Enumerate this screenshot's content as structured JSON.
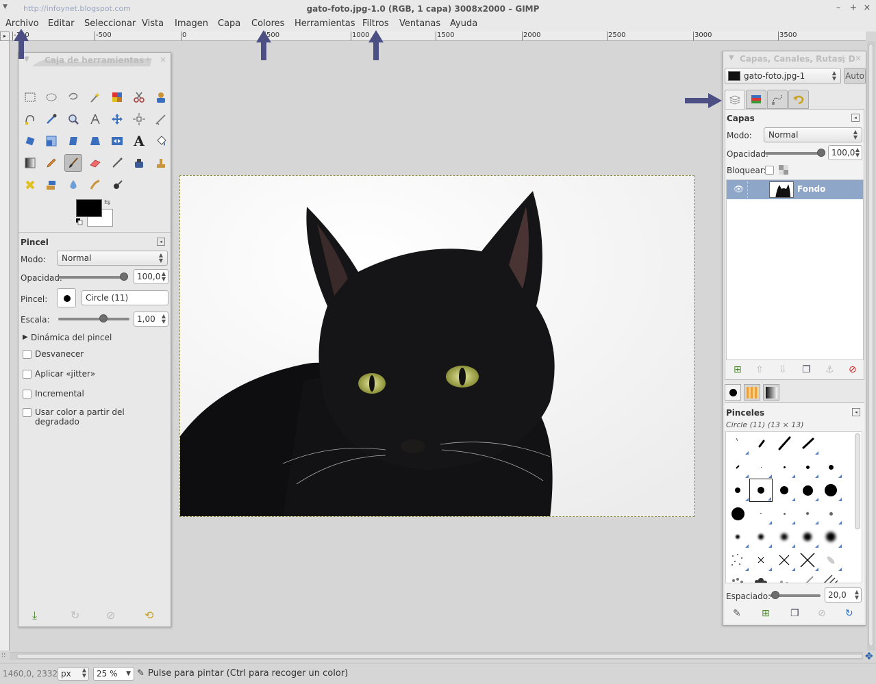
{
  "window": {
    "url": "http://infoynet.blogspot.com",
    "title": "gato-foto.jpg-1.0 (RGB, 1 capa) 3008x2000 – GIMP"
  },
  "menubar": {
    "items": [
      "Archivo",
      "Editar",
      "Seleccionar",
      "Vista",
      "Imagen",
      "Capa",
      "Colores",
      "Herramientas",
      "Filtros",
      "Ventanas",
      "Ayuda"
    ]
  },
  "ruler": {
    "labels": [
      "-100",
      "-500",
      "0",
      "500",
      "1000",
      "1500",
      "2000",
      "2500",
      "3000",
      "3500"
    ]
  },
  "toolbox": {
    "title": "Caja de herramientas",
    "icons": [
      "rect-select-icon",
      "ellipse-select-icon",
      "free-select-icon",
      "fuzzy-select-icon",
      "select-by-color-icon",
      "scissors-icon",
      "foreground-select-icon",
      "paths-icon",
      "color-picker-icon",
      "zoom-icon",
      "measure-icon",
      "move-icon",
      "align-icon",
      "crop-icon",
      "rotate-icon",
      "scale-icon",
      "shear-icon",
      "perspective-icon",
      "flip-icon",
      "text-icon",
      "bucket-fill-icon",
      "blend-icon",
      "pencil-icon",
      "paintbrush-icon",
      "eraser-icon",
      "airbrush-icon",
      "ink-icon",
      "clone-icon",
      "heal-icon",
      "perspective-clone-icon",
      "blur-icon",
      "smudge-icon",
      "dodge-burn-icon"
    ],
    "active_tool": "paintbrush-icon",
    "colors": {
      "foreground": "#000000",
      "background": "#ffffff"
    }
  },
  "tool_options": {
    "header": "Pincel",
    "mode_label": "Modo:",
    "mode_value": "Normal",
    "opacity_label": "Opacidad:",
    "opacity_value": "100,0",
    "opacity_fraction": 1.0,
    "brush_label": "Pincel:",
    "brush_value": "Circle (11)",
    "scale_label": "Escala:",
    "scale_value": "1,00",
    "dynamics_label": "Dinámica del pincel",
    "checks": [
      {
        "label": "Desvanecer",
        "checked": false
      },
      {
        "label": "Aplicar «jitter»",
        "checked": false
      },
      {
        "label": "Incremental",
        "checked": false
      },
      {
        "label": "Usar color a partir del degradado",
        "checked": false
      }
    ]
  },
  "layers_dock": {
    "title": "Capas, Canales, Rutas, D",
    "image_name": "gato-foto.jpg-1",
    "auto_label": "Auto",
    "panel_title": "Capas",
    "mode_label": "Modo:",
    "mode_value": "Normal",
    "opacity_label": "Opacidad:",
    "opacity_value": "100,0",
    "opacity_fraction": 1.0,
    "lock_label": "Bloquear:",
    "layers": [
      {
        "name": "Fondo",
        "visible": true
      }
    ]
  },
  "brushes": {
    "panel_title": "Pinceles",
    "selected_info": "Circle (11) (13 × 13)",
    "spacing_label": "Espaciado:",
    "spacing_value": "20,0",
    "spacing_fraction": 0.2
  },
  "status": {
    "coords": "1460,0, 2332,0",
    "unit": "px",
    "zoom": "25 %",
    "message": "Pulse para pintar (Ctrl para recoger un color)"
  },
  "accent_colors": {
    "selection_blue": "#8ea7c9",
    "arrow": "#4b4f84"
  }
}
